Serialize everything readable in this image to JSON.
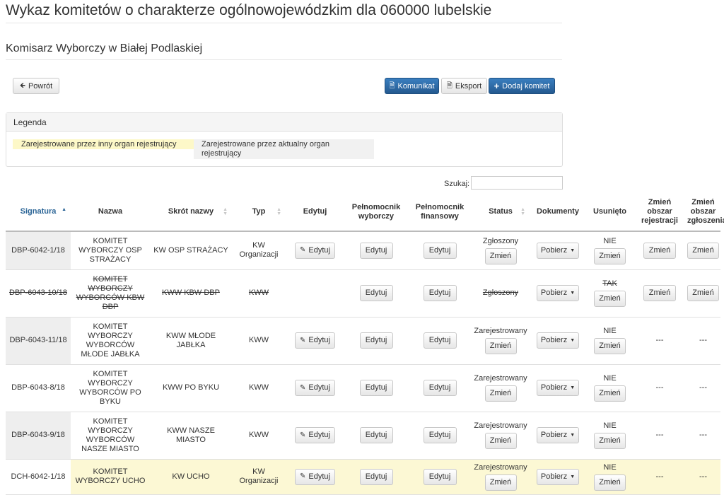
{
  "page": {
    "title": "Wykaz komitetów o charakterze ogólnowojewódzkim dla 060000 lubelskie",
    "subtitle": "Komisarz Wyborczy w Białej Podlaskiej"
  },
  "toolbar": {
    "back_label": "Powrót",
    "komunikat_label": "Komunikat",
    "eksport_label": "Eksport",
    "add_label": "Dodaj komitet"
  },
  "legend": {
    "heading": "Legenda",
    "other_org": "Zarejestrowane przez inny organ rejestrujący",
    "current_org": "Zarejestrowane przez aktualny organ rejestrujący"
  },
  "search": {
    "label": "Szukaj:",
    "value": ""
  },
  "table": {
    "headers": {
      "signature": "Signatura",
      "name": "Nazwa",
      "short": "Skrót nazwy",
      "type": "Typ",
      "edit": "Edytuj",
      "proxy": "Pełnomocnik wyborczy",
      "finance": "Pełnomocnik finansowy",
      "status": "Status",
      "docs": "Dokumenty",
      "deleted": "Usunięto",
      "reg_area": "Zmień obszar rejestracji",
      "sub_area": "Zmień obszar zgłoszenia"
    },
    "labels": {
      "edit": "Edytuj",
      "change": "Zmień",
      "download": "Pobierz",
      "dash": "---"
    },
    "rows": [
      {
        "signature": "DBP-6042-1/18",
        "name": "KOMITET WYBORCZY OSP STRAŻACY",
        "short": "KW OSP STRAŻACY",
        "type": "KW Organizacji",
        "status": "Zgłoszony",
        "deleted": "NIE"
      },
      {
        "signature": "DBP-6043-10/18",
        "name": "KOMITET WYBORCZY WYBORCÓW KBW DBP",
        "short": "KWW KBW DBP",
        "type": "KWW",
        "status": "Zgłoszony",
        "deleted": "TAK"
      },
      {
        "signature": "DBP-6043-11/18",
        "name": "KOMITET WYBORCZY WYBORCÓW MŁODE JABŁKA",
        "short": "KWW MŁODE JABŁKA",
        "type": "KWW",
        "status": "Zarejestrowany",
        "deleted": "NIE"
      },
      {
        "signature": "DBP-6043-8/18",
        "name": "KOMITET WYBORCZY WYBORCÓW PO BYKU",
        "short": "KWW PO BYKU",
        "type": "KWW",
        "status": "Zarejestrowany",
        "deleted": "NIE"
      },
      {
        "signature": "DBP-6043-9/18",
        "name": "KOMITET WYBORCZY WYBORCÓW NASZE MIASTO",
        "short": "KWW NASZE MIASTO",
        "type": "KWW",
        "status": "Zarejestrowany",
        "deleted": "NIE"
      },
      {
        "signature": "DCH-6042-1/18",
        "name": "KOMITET WYBORCZY UCHO",
        "short": "KW UCHO",
        "type": "KW Organizacji",
        "status": "Zarejestrowany",
        "deleted": "NIE"
      }
    ]
  },
  "colors": {
    "primary": "#2a6496",
    "legend_other": "#fdf8c8",
    "legend_current": "#f1f1f1"
  }
}
